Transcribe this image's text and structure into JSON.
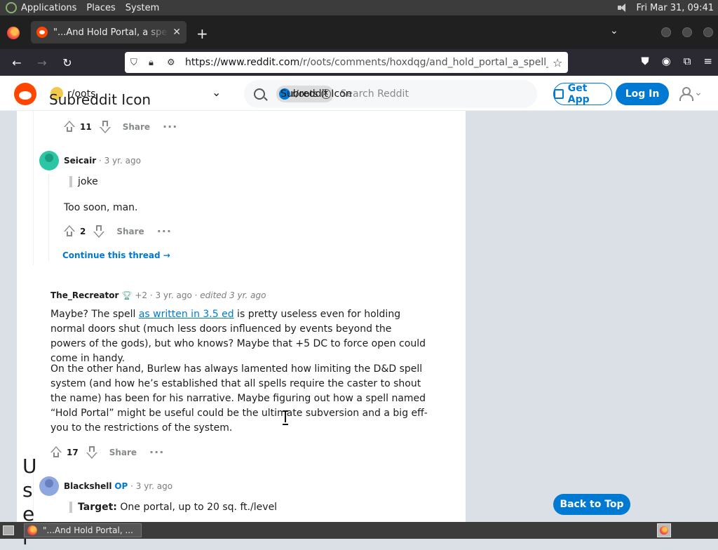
{
  "system_panel": {
    "menus": [
      "Applications",
      "Places",
      "System"
    ],
    "clock": "Fri Mar 31, 09:41"
  },
  "browser": {
    "tab_title": "\"...And Hold Portal, a spell th",
    "url_domain": "https://www.reddit.com",
    "url_path": "/r/oots/comments/hoxdqg/and_hold_portal_a_spell_that_"
  },
  "reddit_header": {
    "subreddit": "r/oots",
    "subreddit_icon_alt": "Subreddit Icon",
    "search_chip": "r/oots",
    "search_chip_alt": "Subreddit Icon",
    "search_placeholder": "Search Reddit",
    "get_app": "Get App",
    "login": "Log In"
  },
  "comments": {
    "c1": {
      "score": "11",
      "share": "Share"
    },
    "c2": {
      "author": "Seicair",
      "age": "3 yr. ago",
      "quote": "joke",
      "text": "Too soon, man.",
      "score": "2",
      "share": "Share",
      "continue": "Continue this thread"
    },
    "c3": {
      "author": "The_Recreator",
      "flair_count": "+2",
      "age": "3 yr. ago",
      "edited": "edited 3 yr. ago",
      "p1_before": "Maybe? The spell ",
      "p1_link": "as written in 3.5 ed",
      "p1_after": " is pretty useless even for holding normal doors shut (much less doors influenced by events beyond the powers of the gods), but who knows? Maybe that +5 DC to force open could come in handy.",
      "p2": "On the other hand, Burlew has always lamented how limiting the D&D spell system (and how he’s established that all spells require the caster to shout the name) has been for his narrative. Maybe figuring out how a spell named “Hold Portal” might be useful could be the ultimate subversion and a big eff-you to the restrictions of the system.",
      "score": "17",
      "share": "Share"
    },
    "c4": {
      "author": "Blackshell",
      "op": "OP",
      "age": "3 yr. ago",
      "target_label": "Target:",
      "target_text": " One portal, up to 20 sq. ft./level"
    },
    "user_alt": "User"
  },
  "back_to_top": "Back to Top",
  "taskbar": {
    "task_title": "\"...And Hold Portal, ..."
  },
  "colors": {
    "reddit_orange": "#ff4500",
    "reddit_blue": "#0079d3",
    "page_bg": "#dae0e6"
  }
}
